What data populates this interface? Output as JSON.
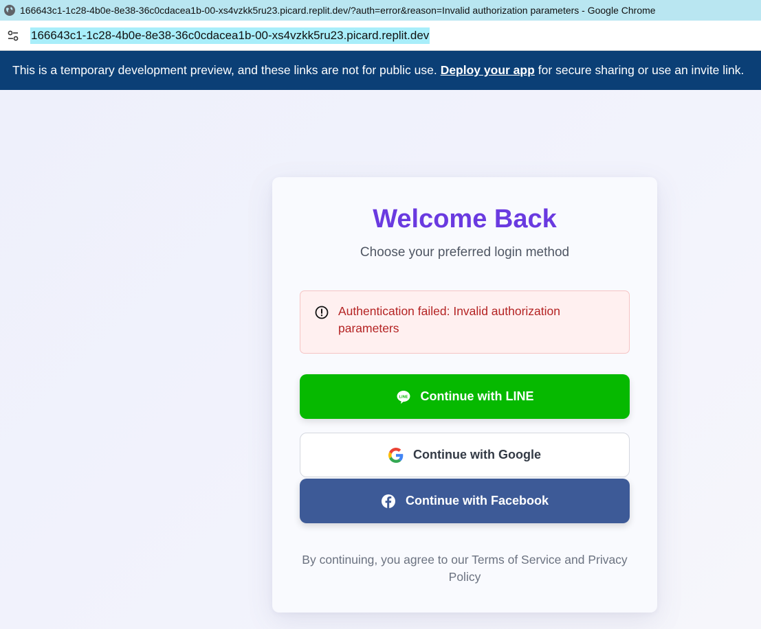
{
  "browser": {
    "window_title": "166643c1-1c28-4b0e-8e38-36c0cdacea1b-00-xs4vzkk5ru23.picard.replit.dev/?auth=error&reason=Invalid authorization parameters - Google Chrome",
    "url": "166643c1-1c28-4b0e-8e38-36c0cdacea1b-00-xs4vzkk5ru23.picard.replit.dev",
    "globe_icon": "globe-icon",
    "site_info_icon": "tune-icon"
  },
  "banner": {
    "text_before": "This is a temporary development preview, and these links are not for public use.",
    "link": "Deploy your app",
    "text_after": "for secure sharing or use an invite link.",
    "background": "#0b3f76"
  },
  "login": {
    "title": "Welcome Back",
    "subtitle": "Choose your preferred login method",
    "error": {
      "icon": "alert-circle-icon",
      "message": "Authentication failed: Invalid authorization parameters"
    },
    "buttons": {
      "line": {
        "label": "Continue with LINE",
        "icon": "line-icon",
        "color": "#06b900"
      },
      "google": {
        "label": "Continue with Google",
        "icon": "google-icon",
        "color": "#ffffff"
      },
      "facebook": {
        "label": "Continue with Facebook",
        "icon": "facebook-icon",
        "color": "#3d5a97"
      }
    },
    "terms": "By continuing, you agree to our Terms of Service and Privacy Policy",
    "accent_color": "#6a3ae0"
  }
}
